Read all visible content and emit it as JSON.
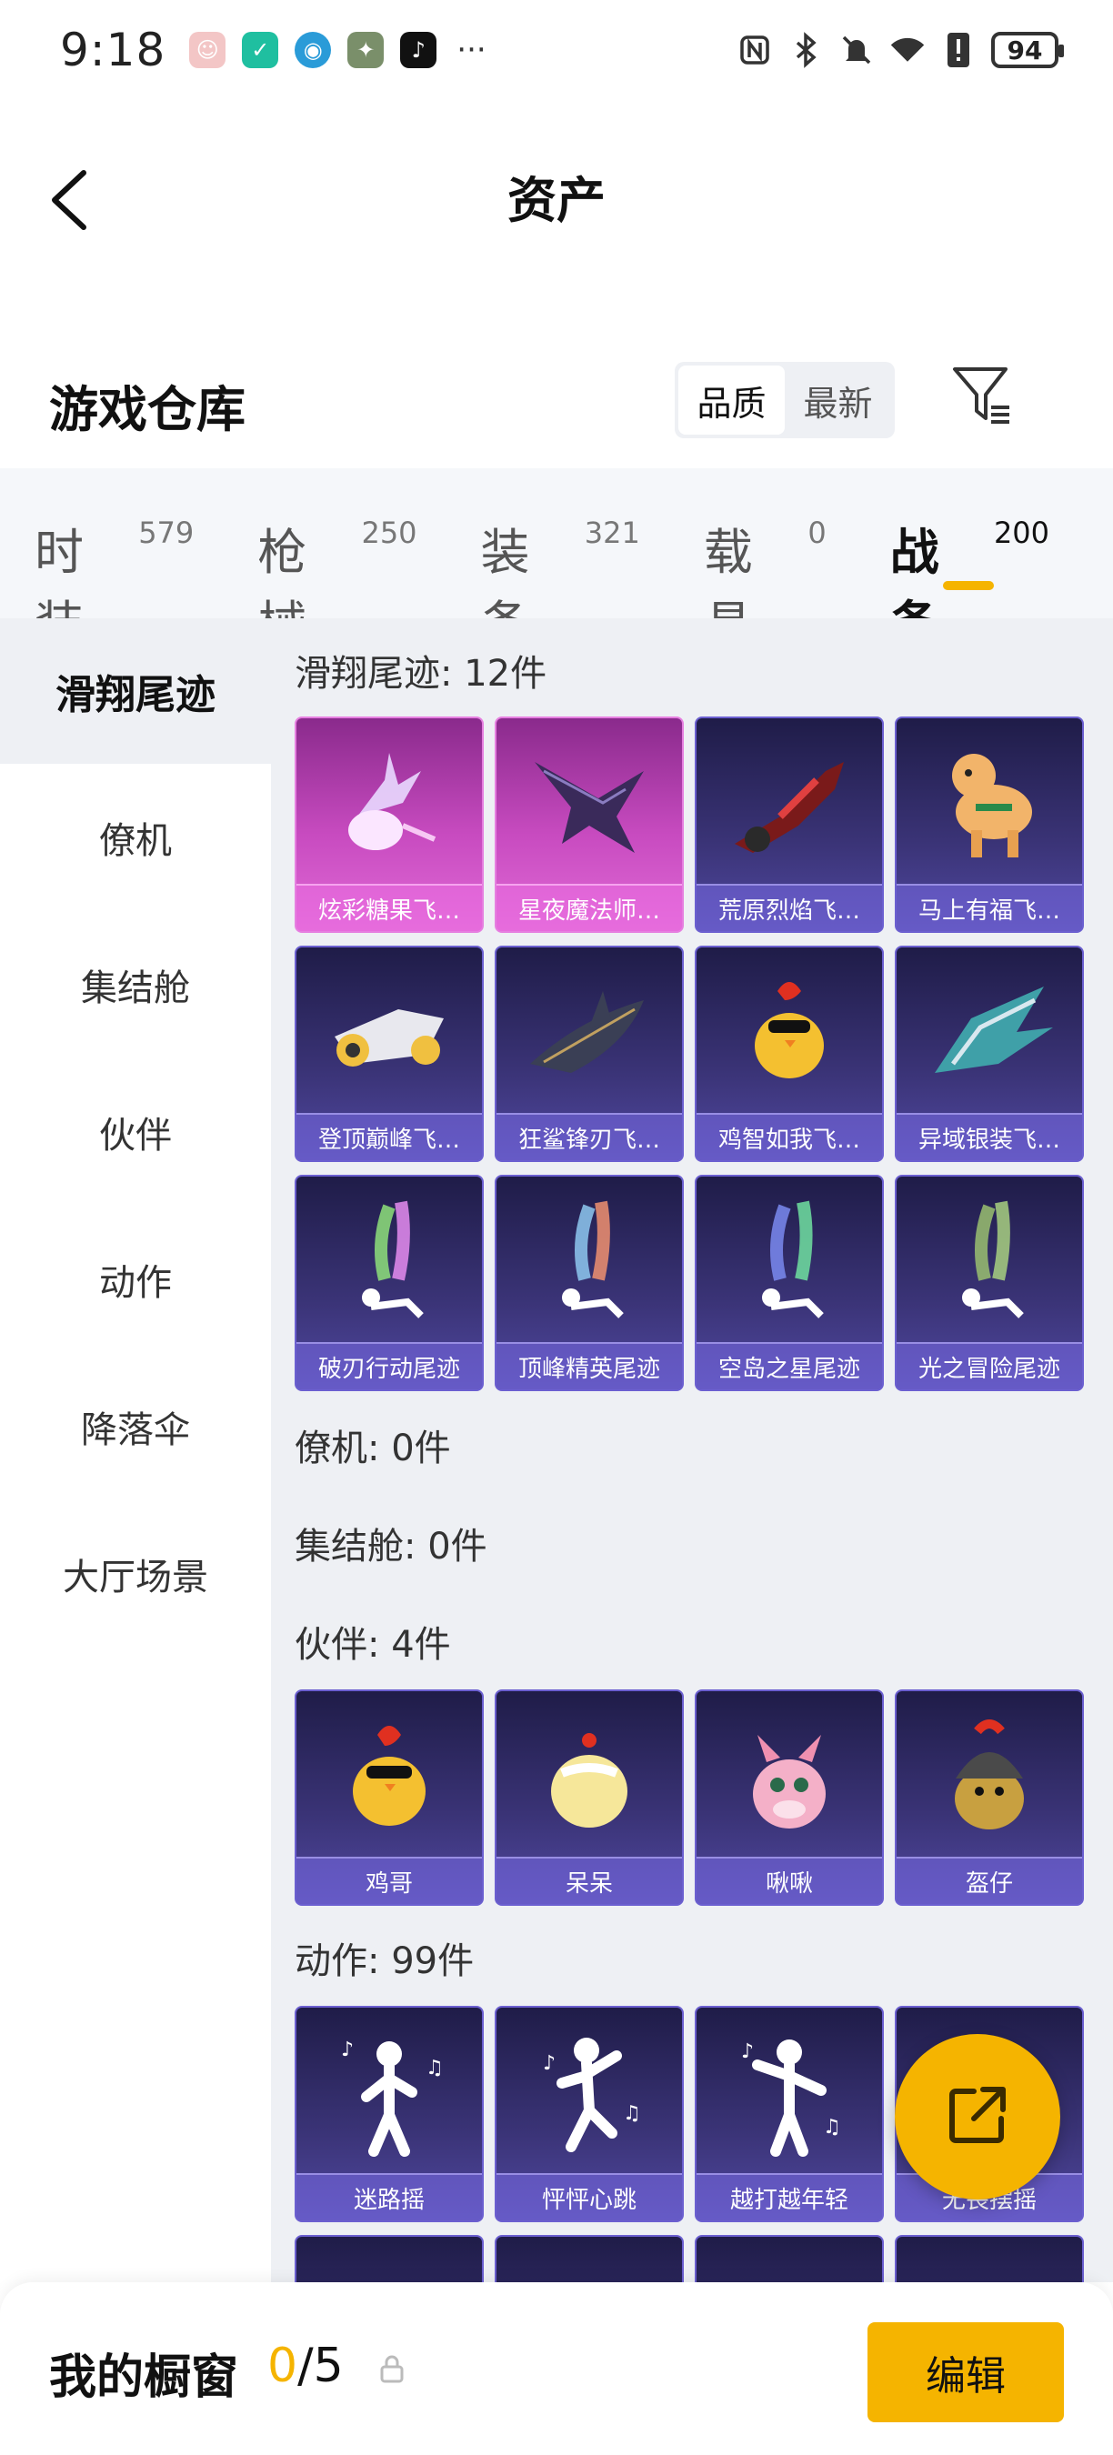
{
  "status_bar": {
    "time": "9:18",
    "more": "···",
    "battery": "94"
  },
  "header": {
    "title": "资产"
  },
  "warehouse": {
    "title": "游戏仓库",
    "sort_options": [
      "品质",
      "最新"
    ],
    "active_sort": "品质"
  },
  "tabs": [
    {
      "label": "时装",
      "count": "579"
    },
    {
      "label": "枪械",
      "count": "250"
    },
    {
      "label": "装备",
      "count": "321"
    },
    {
      "label": "载具",
      "count": "0"
    },
    {
      "label": "战备",
      "count": "200",
      "active": true
    }
  ],
  "side_nav": [
    "滑翔尾迹",
    "僚机",
    "集结舱",
    "伙伴",
    "动作",
    "降落伞",
    "大厅场景"
  ],
  "sections": {
    "glide": {
      "heading": "滑翔尾迹: 12件",
      "items": [
        "炫彩糖果飞…",
        "星夜魔法师…",
        "荒原烈焰飞…",
        "马上有福飞…",
        "登顶巅峰飞…",
        "狂鲨锋刃飞…",
        "鸡智如我飞…",
        "异域银装飞…",
        "破刃行动尾迹",
        "顶峰精英尾迹",
        "空岛之星尾迹",
        "光之冒险尾迹"
      ]
    },
    "wingman": {
      "heading": "僚机: 0件"
    },
    "pod": {
      "heading": "集结舱: 0件"
    },
    "partner": {
      "heading": "伙伴: 4件",
      "items": [
        "鸡哥",
        "呆呆",
        "啾啾",
        "盔仔"
      ]
    },
    "action": {
      "heading": "动作: 99件",
      "items": [
        "迷路摇",
        "怦怦心跳",
        "越打越年轻",
        "无畏摆摇"
      ]
    }
  },
  "bottom_bar": {
    "title": "我的橱窗",
    "current": "0",
    "separator": "/",
    "total": "5",
    "edit_label": "编辑"
  },
  "colors": {
    "accent": "#f5b400",
    "card_purple": "#3b3478",
    "card_pink": "#c84bc0"
  }
}
